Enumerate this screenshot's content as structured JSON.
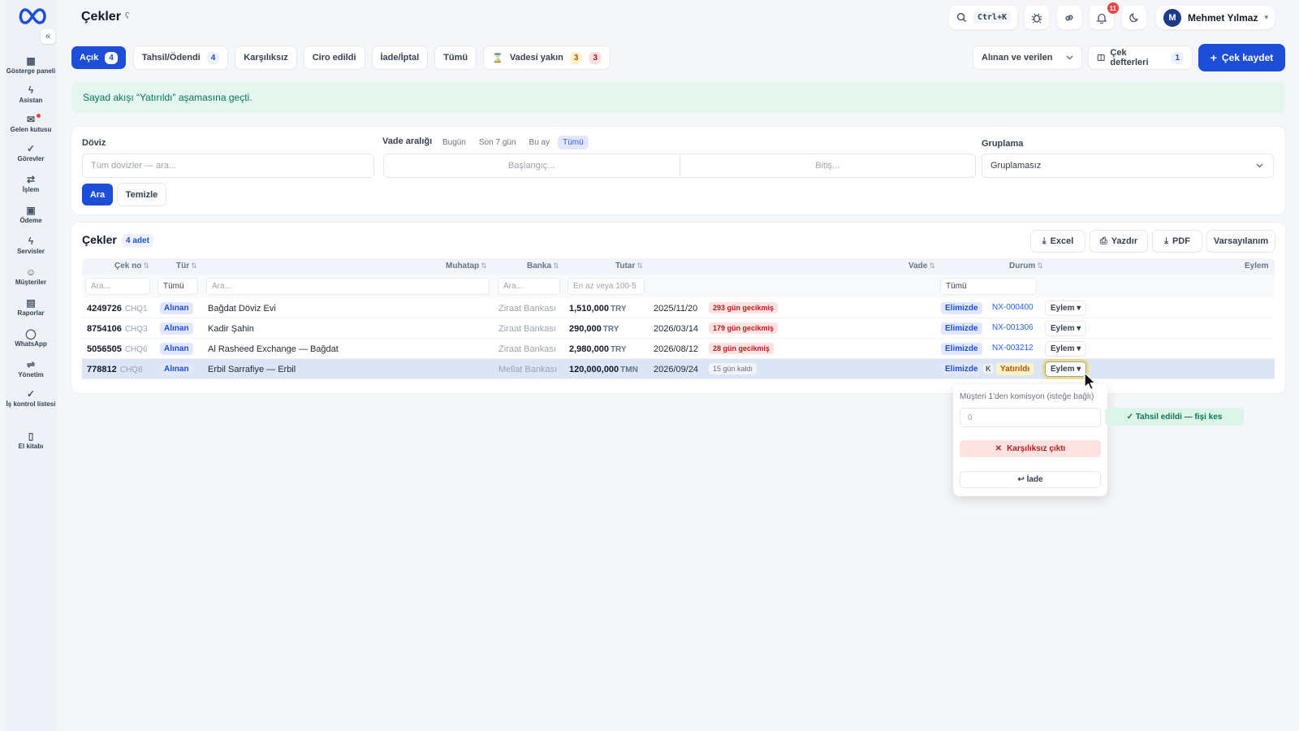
{
  "app": {
    "title": "Çekler",
    "help": "ʕ"
  },
  "sidebar": {
    "collapse": "«",
    "items": [
      {
        "label": "Gösterge paneli",
        "icon": "dashboard-icon",
        "glyph": "▦"
      },
      {
        "label": "Asistan",
        "icon": "bolt-icon",
        "glyph": "ϟ"
      },
      {
        "label": "Gelen kutusu",
        "icon": "inbox-icon",
        "glyph": "✉"
      },
      {
        "label": "Görevler",
        "icon": "check-icon",
        "glyph": "✓"
      },
      {
        "label": "İşlem",
        "icon": "transfer-icon",
        "glyph": "⇄"
      },
      {
        "label": "Ödeme",
        "icon": "payment-icon",
        "glyph": "▣"
      },
      {
        "label": "Servisler",
        "icon": "bolt-icon",
        "glyph": "ϟ"
      },
      {
        "label": "Müşteriler",
        "icon": "users-icon",
        "glyph": "☺"
      },
      {
        "label": "Raporlar",
        "icon": "report-icon",
        "glyph": "▤"
      },
      {
        "label": "WhatsApp",
        "icon": "whatsapp-icon",
        "glyph": "◯"
      },
      {
        "label": "Yönetim",
        "icon": "settings-sliders-icon",
        "glyph": "⇌"
      },
      {
        "label": "İş kontrol listesi",
        "icon": "checklist-icon",
        "glyph": "✓"
      },
      {
        "label": "El kitabı",
        "icon": "book-icon",
        "glyph": "▯"
      }
    ]
  },
  "header": {
    "search_kbd": "Ctrl+K",
    "notif_count": "11",
    "user_initial": "M",
    "user_name": "Mehmet Yılmaz",
    "user_caret": "▾"
  },
  "tabs": [
    {
      "label": "Açık",
      "count": "4"
    },
    {
      "label": "Tahsil/Ödendi",
      "count": "4"
    },
    {
      "label": "Karşılıksız"
    },
    {
      "label": "Ciro edildi"
    },
    {
      "label": "İade/İptal"
    },
    {
      "label": "Tümü"
    },
    {
      "label": "Vadesi yakın",
      "count_a": "3",
      "count_b": "3"
    }
  ],
  "toolbar": {
    "direction_value": "Alınan ve verilen",
    "books_label": "Çek defterleri",
    "books_count": "1",
    "new_check_label": "Çek kaydet"
  },
  "alert": {
    "text": "Sayad akışı “Yatırıldı” aşamasına geçti."
  },
  "filters": {
    "currency_label": "Döviz",
    "currency_placeholder": "Tüm dövizler — ara...",
    "due_label": "Vade aralığı",
    "due_chips": [
      "Bugün",
      "Son 7 gün",
      "Bu ay",
      "Tümü"
    ],
    "start_placeholder": "Başlangıç...",
    "end_placeholder": "Bitiş...",
    "group_label": "Gruplama",
    "group_value": "Gruplamasız",
    "search_btn": "Ara",
    "clear_btn": "Temizle"
  },
  "table": {
    "title": "Çekler",
    "count": "4 adet",
    "buttons": {
      "excel": "Excel",
      "print": "Yazdır",
      "pdf": "PDF",
      "defaults": "Varsayılanım"
    },
    "headers": {
      "no": "Çek no",
      "type": "Tür",
      "party": "Muhatap",
      "bank": "Banka",
      "amount": "Tutar",
      "due": "Vade",
      "status": "Durum",
      "action": "Eylem"
    },
    "sort": "⇅",
    "filters": {
      "no": "Ara...",
      "type": "Tümü",
      "party": "Ara...",
      "bank": "Ara...",
      "amount": "En az veya 100-5",
      "status": "Tümü"
    },
    "rows": [
      {
        "no": "4249726",
        "code": "CHQ1",
        "type": "Alınan",
        "party": "Bağdat Döviz Evi",
        "bank": "Ziraat Bankası",
        "amount": "1,510,000",
        "cur": "TRY",
        "due": "2025/11/20",
        "due_note": "293 gün gecikmiş",
        "status": "Elimizde",
        "ref": "NX-000400",
        "action": "Eylem ▾"
      },
      {
        "no": "8754106",
        "code": "CHQ3",
        "type": "Alınan",
        "party": "Kadir Şahin",
        "bank": "Ziraat Bankası",
        "amount": "290,000",
        "cur": "TRY",
        "due": "2026/03/14",
        "due_note": "179 gün gecikmiş",
        "status": "Elimizde",
        "ref": "NX-001306",
        "action": "Eylem ▾"
      },
      {
        "no": "5056505",
        "code": "CHQ6",
        "type": "Alınan",
        "party": "Al Rasheed Exchange — Bağdat",
        "bank": "Ziraat Bankası",
        "amount": "2,980,000",
        "cur": "TRY",
        "due": "2026/08/12",
        "due_note": "28 gün gecikmiş",
        "status": "Elimizde",
        "ref": "NX-003212",
        "action": "Eylem ▾"
      },
      {
        "no": "778812",
        "code": "CHQ8",
        "type": "Alınan",
        "party": "Erbil Sarrafiye — Erbil",
        "bank": "Mellat Bankası",
        "amount": "120,000,000",
        "cur": "TMN",
        "due": "2026/09/24",
        "due_note": "15 gün kaldı",
        "status": "Elimizde",
        "k": "K",
        "deposited": "Yatırıldı",
        "action": "Eylem ▾"
      }
    ]
  },
  "popup": {
    "commission_label": "Müşteri 1'den komisyon (isteğe bağlı)",
    "commission_placeholder": "0",
    "bounce": "Karşılıksız çıktı",
    "return": "↩ İade",
    "collected": "✓ Tahsil edildi — fişi kes"
  },
  "colors": {
    "primary": "#1d4ed8",
    "success": "#047857",
    "danger": "#b91c1c"
  }
}
